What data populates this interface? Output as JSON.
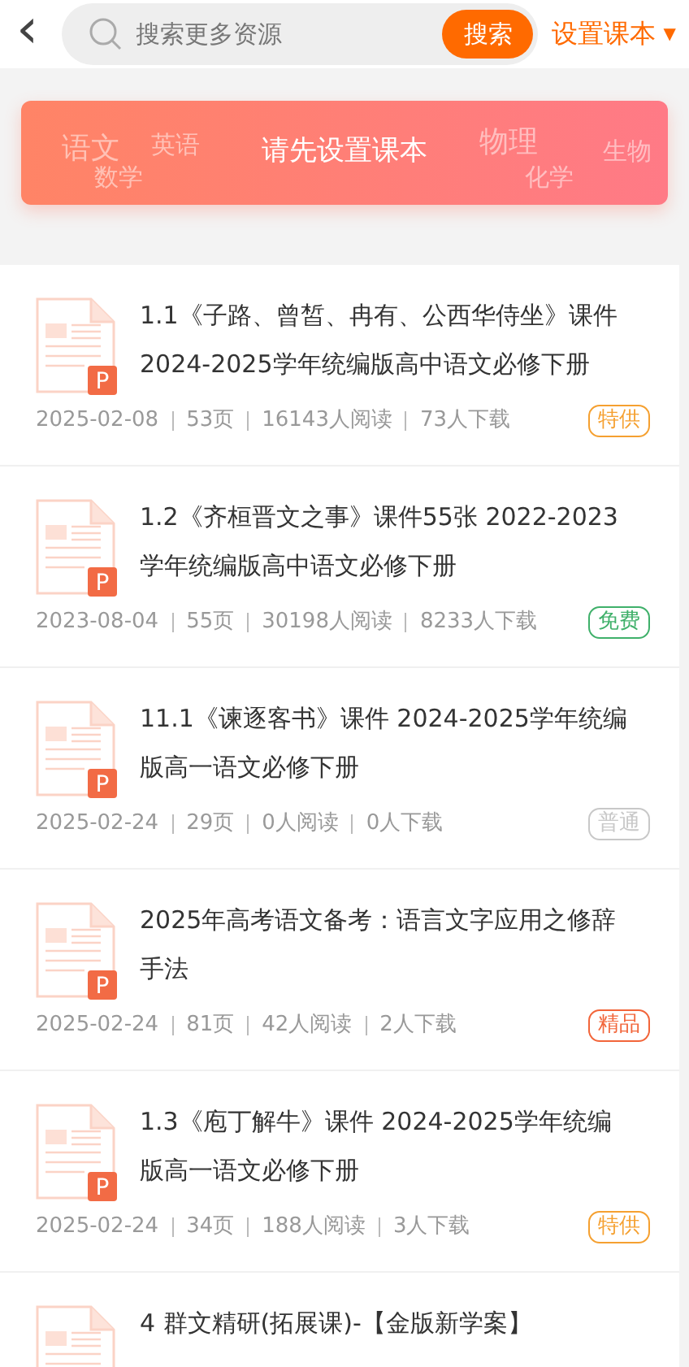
{
  "header": {
    "back": "‹",
    "search": {
      "placeholder": "搜索更多资源",
      "button": "搜索"
    },
    "textbook_menu": {
      "label": "设置课本",
      "caret": "▼"
    }
  },
  "banner": {
    "title": "请先设置课本",
    "subjects": [
      "语文",
      "英语",
      "数学",
      "物理",
      "化学",
      "生物"
    ]
  },
  "resources": [
    {
      "title": "1.1《子路、曾皙、冉有、公西华侍坐》课件2024-2025学年统编版高中语文必修下册",
      "date": "2025-02-08",
      "pages": "53页",
      "reads": "16143人阅读",
      "downloads": "73人下载",
      "tag": "特供",
      "color": "#f5a030",
      "file_badge": "P"
    },
    {
      "title": "1.2《齐桓晋文之事》课件55张 2022-2023学年统编版高中语文必修下册",
      "date": "2023-08-04",
      "pages": "55页",
      "reads": "30198人阅读",
      "downloads": "8233人下载",
      "tag": "免费",
      "color": "#3fb06a",
      "file_badge": "P"
    },
    {
      "title": "11.1《谏逐客书》课件 2024-2025学年统编版高一语文必修下册",
      "date": "2025-02-24",
      "pages": "29页",
      "reads": "0人阅读",
      "downloads": "0人下载",
      "tag": "普通",
      "color": "#c8c8c8",
      "file_badge": "P"
    },
    {
      "title": "2025年高考语文备考：语言文字应用之修辞手法",
      "date": "2025-02-24",
      "pages": "81页",
      "reads": "42人阅读",
      "downloads": "2人下载",
      "tag": "精品",
      "color": "#f2653a",
      "file_badge": "P"
    },
    {
      "title": "1.3《庖丁解牛》课件 2024-2025学年统编版高一语文必修下册",
      "date": "2025-02-24",
      "pages": "34页",
      "reads": "188人阅读",
      "downloads": "3人下载",
      "tag": "特供",
      "color": "#f5a030",
      "file_badge": "P"
    },
    {
      "title": "4 群文精研(拓展课)-【金版新学案】"
    }
  ]
}
